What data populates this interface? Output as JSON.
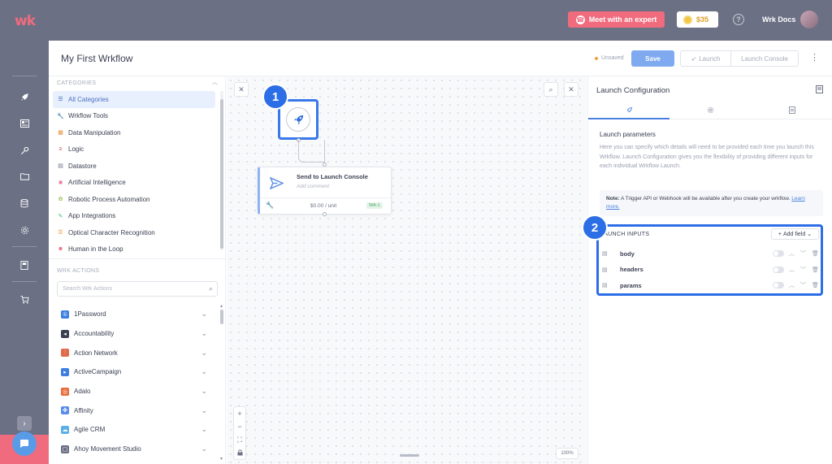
{
  "topbar": {
    "logo": "wk",
    "expert_label": "Meet with an expert",
    "credits": "$35",
    "help": "?",
    "org_name": "Wrk Docs"
  },
  "rail": {
    "icons": [
      "rocket-icon",
      "dashboard-icon",
      "key-icon",
      "folder-icon",
      "database-icon",
      "settings-icon",
      "book-icon",
      "cart-icon"
    ],
    "toggle": "›",
    "chat": "▬"
  },
  "header": {
    "title": "My First Wrkflow",
    "status": "Unsaved",
    "save_label": "Save",
    "launch_label": "Launch",
    "console_label": "Launch Console",
    "more": "⋮"
  },
  "categories": {
    "title": "CATEGORIES",
    "items": [
      {
        "label": "All Categories",
        "icon": "list-icon",
        "color": "#4a6fc0"
      },
      {
        "label": "Wrkflow Tools",
        "icon": "wrench-icon",
        "color": "#5a8de8"
      },
      {
        "label": "Data Manipulation",
        "icon": "data-icon",
        "color": "#e8923a"
      },
      {
        "label": "Logic",
        "icon": "logic-icon",
        "color": "#d84a4a"
      },
      {
        "label": "Datastore",
        "icon": "datastore-icon",
        "color": "#6b7084"
      },
      {
        "label": "Artificial Intelligence",
        "icon": "ai-icon",
        "color": "#e86b9a"
      },
      {
        "label": "Robotic Process Automation",
        "icon": "robot-icon",
        "color": "#9ac04a"
      },
      {
        "label": "App Integrations",
        "icon": "plug-icon",
        "color": "#4ac07a"
      },
      {
        "label": "Optical Character Recognition",
        "icon": "ocr-icon",
        "color": "#e8a03a"
      },
      {
        "label": "Human in the Loop",
        "icon": "human-icon",
        "color": "#e86b7d"
      }
    ]
  },
  "actions": {
    "title": "WRK ACTIONS",
    "search_placeholder": "Search Wrk Actions",
    "items": [
      {
        "label": "1Password",
        "color": "#3b7de0",
        "glyph": "①"
      },
      {
        "label": "Accountability",
        "color": "#3a3f52",
        "glyph": "◂"
      },
      {
        "label": "Action Network",
        "color": "#e06b4a",
        "glyph": "⫶"
      },
      {
        "label": "ActiveCampaign",
        "color": "#3b7de0",
        "glyph": "▸"
      },
      {
        "label": "Adalo",
        "color": "#e86b3a",
        "glyph": "◎"
      },
      {
        "label": "Affinity",
        "color": "#5a8de8",
        "glyph": "✤"
      },
      {
        "label": "Agile CRM",
        "color": "#5ab0e8",
        "glyph": "☁"
      },
      {
        "label": "Ahoy Movement Studio",
        "color": "#6b7084",
        "glyph": "▢"
      }
    ]
  },
  "canvas": {
    "trigger_badge": "1",
    "trigger_icon": "rocket-icon",
    "node_name": "Send to Launch Console",
    "node_comment": "Add comment",
    "node_price": "$0.00 / unit",
    "node_code": "WA-1",
    "zoom_percent": "100%",
    "close": "✕",
    "search": "⌕"
  },
  "config": {
    "title": "Launch Configuration",
    "tabs": [
      "rocket-icon",
      "gear-icon",
      "doc-icon"
    ],
    "params_title": "Launch parameters",
    "params_desc": "Here you can specify which details will need to be provided each time you launch this Wrkflow. Launch Configuration gives you the flexibility of providing different inputs for each individual Wrkflow Launch.",
    "note_bold": "Note:",
    "note_text": " A Trigger API or Webhook will be available after you create your wrkflow. ",
    "note_link": "Learn more.",
    "badge": "2",
    "inputs_title": "LAUNCH INPUTS",
    "add_field_label": "Add field",
    "fields": [
      {
        "name": "body"
      },
      {
        "name": "headers"
      },
      {
        "name": "params"
      }
    ]
  },
  "colors": {
    "accent": "#2c6ee6",
    "brand": "#f06b7d",
    "chrome": "#6b7084"
  }
}
